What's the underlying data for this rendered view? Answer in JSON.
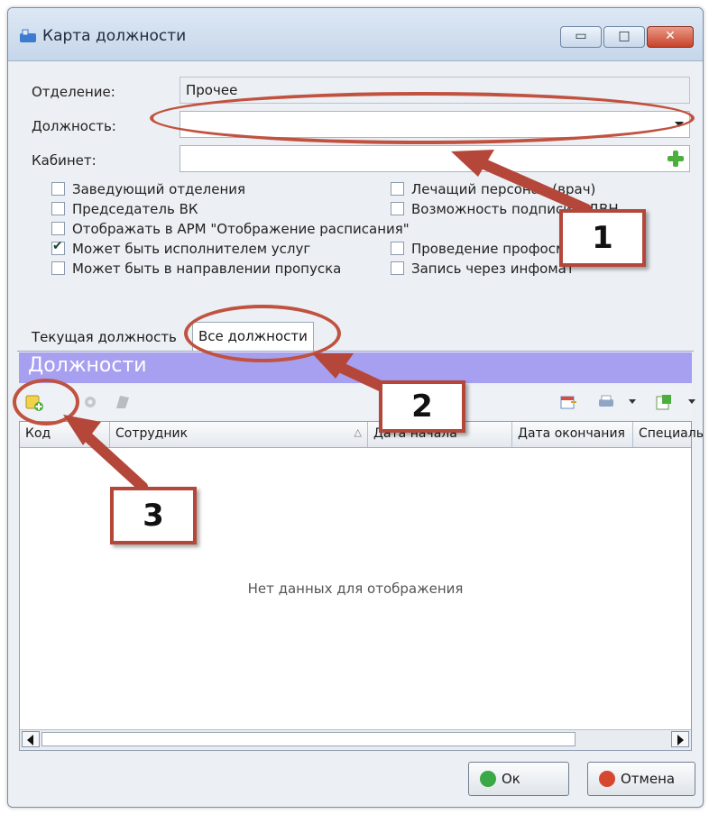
{
  "window": {
    "title": "Карта должности",
    "title_icon": "app-icon",
    "controls": {
      "minimize": "▭",
      "maximize": "□",
      "close": "✕"
    }
  },
  "form": {
    "department_label": "Отделение:",
    "department_value": "Прочее",
    "position_label": "Должность:",
    "position_value": "",
    "cabinet_label": "Кабинет:",
    "cabinet_value": ""
  },
  "checkboxes": {
    "left": [
      {
        "label": "Заведующий отделения",
        "checked": false
      },
      {
        "label": "Председатель ВК",
        "checked": false
      },
      {
        "label": "Отображать в АРМ \"Отображение расписания\"",
        "checked": false
      },
      {
        "label": "Может быть исполнителем услуг",
        "checked": true
      },
      {
        "label": "Может быть в направлении пропуска",
        "checked": false
      }
    ],
    "right": [
      {
        "label": "Лечащий персонал (врач)",
        "checked": false
      },
      {
        "label": "Возможность подписи в ДВН",
        "checked": false
      },
      {
        "label": "Проведение профосмотра",
        "checked": false
      },
      {
        "label": "Запись через инфомат",
        "checked": false
      }
    ]
  },
  "tabs": [
    {
      "label": "Текущая должность",
      "active": false
    },
    {
      "label": "Все должности",
      "active": true
    }
  ],
  "group": {
    "title": "Должности"
  },
  "grid": {
    "columns": [
      "Код",
      "Сотрудник",
      "Дата начала",
      "Дата окончания",
      "Специальность"
    ],
    "sort_indicator": "△",
    "empty_text": "Нет данных для отображения"
  },
  "buttons": {
    "ok": "Ок",
    "cancel": "Отмена"
  },
  "annotations": [
    "1",
    "2",
    "3"
  ],
  "colors": {
    "group_header": "#a79ff0",
    "annotation": "#b5473a",
    "ok_icon": "#3aa845",
    "cancel_icon": "#d6472f"
  }
}
